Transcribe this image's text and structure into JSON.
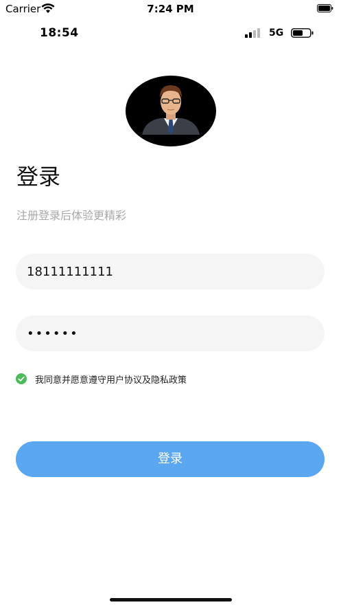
{
  "sim_status_bar": {
    "carrier": "Carrier",
    "time": "7:24 PM"
  },
  "app_status_bar": {
    "time": "18:54",
    "network": "5G"
  },
  "login": {
    "title": "登录",
    "subtitle": "注册登录后体验更精彩",
    "phone_value": "18111111111",
    "password_value": "••••••",
    "agreement_text": "我同意并愿意遵守用户协议及隐私政策",
    "agreement_checked": true,
    "button_label": "登录"
  },
  "colors": {
    "primary_button": "#5aa6f1",
    "input_background": "#f5f5f5",
    "check_green": "#4cbb5a",
    "subtitle_gray": "#a8a8a8"
  },
  "icons": [
    "wifi-icon",
    "battery-icon",
    "signal-icon",
    "avatar",
    "check-icon"
  ]
}
